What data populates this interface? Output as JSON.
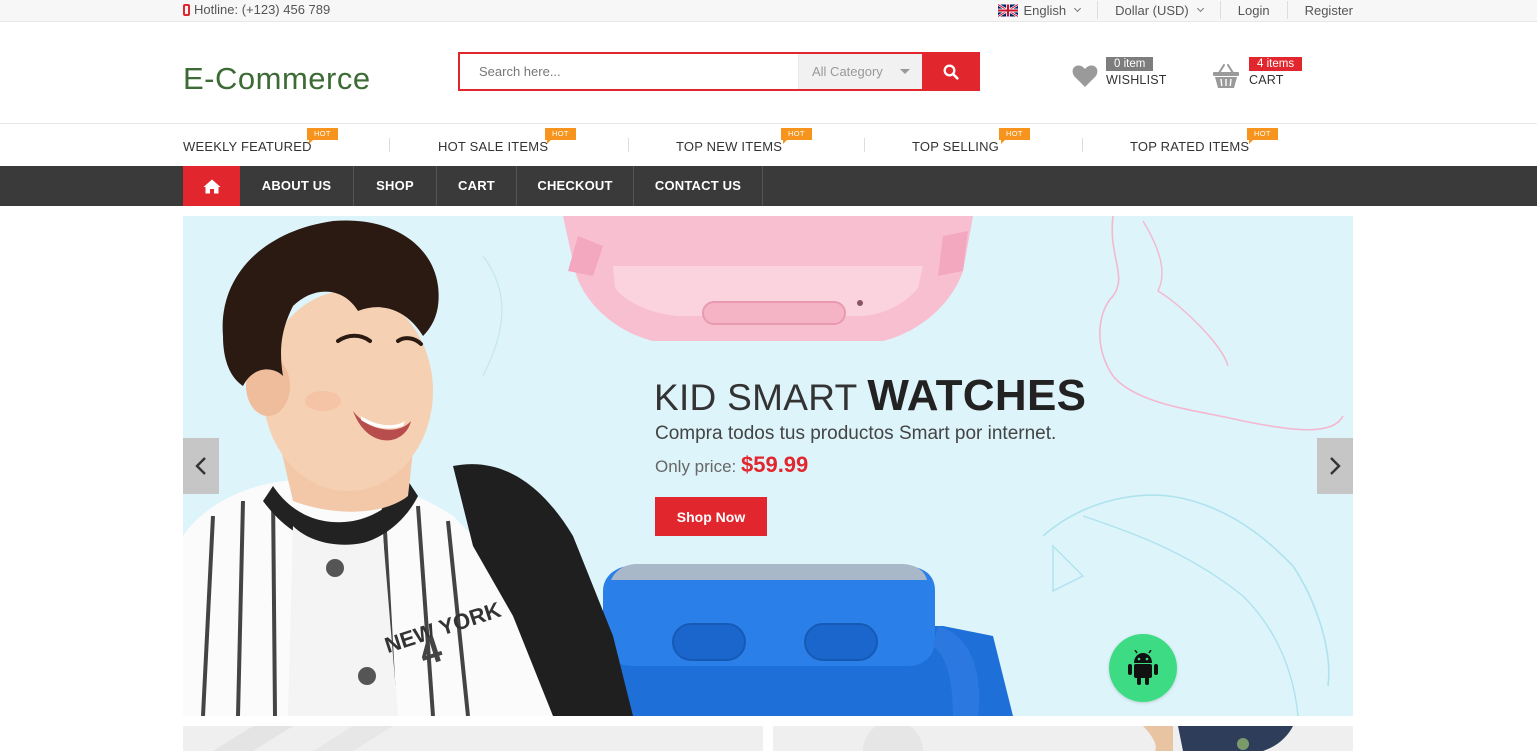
{
  "topbar": {
    "hotline": "Hotline: (+123) 456 789",
    "language": "English",
    "currency": "Dollar (USD)",
    "login": "Login",
    "register": "Register"
  },
  "header": {
    "logo": "E-Commerce",
    "search_placeholder": "Search here...",
    "category": "All Category",
    "wishlist_count": "0 item",
    "wishlist_label": "WISHLIST",
    "cart_count": "4 items",
    "cart_label": "CART"
  },
  "featured": {
    "items": [
      {
        "label": "WEEKLY FEATURED",
        "badge": "HOT"
      },
      {
        "label": "HOT SALE ITEMS",
        "badge": "HOT"
      },
      {
        "label": "TOP NEW ITEMS",
        "badge": "HOT"
      },
      {
        "label": "TOP SELLING",
        "badge": "HOT"
      },
      {
        "label": "TOP RATED ITEMS",
        "badge": "HOT"
      }
    ]
  },
  "nav": {
    "items": [
      "ABOUT US",
      "SHOP",
      "CART",
      "CHECKOUT",
      "CONTACT US"
    ]
  },
  "banner": {
    "title_light": "KID SMART ",
    "title_bold": "WATCHES",
    "subtitle": "Compra todos tus productos Smart por internet.",
    "price_label": "Only price: ",
    "price": "$59.99",
    "button": "Shop Now"
  },
  "icons": {
    "phone": "phone-icon",
    "search": "search-icon",
    "heart": "heart-icon",
    "basket": "basket-icon",
    "home": "home-icon",
    "android": "android-icon"
  },
  "colors": {
    "accent": "#e2262d",
    "logo": "#3d6b35",
    "hot_badge": "#f7941d",
    "nav_bg": "#3a3a3a",
    "android": "#3ddc84"
  }
}
